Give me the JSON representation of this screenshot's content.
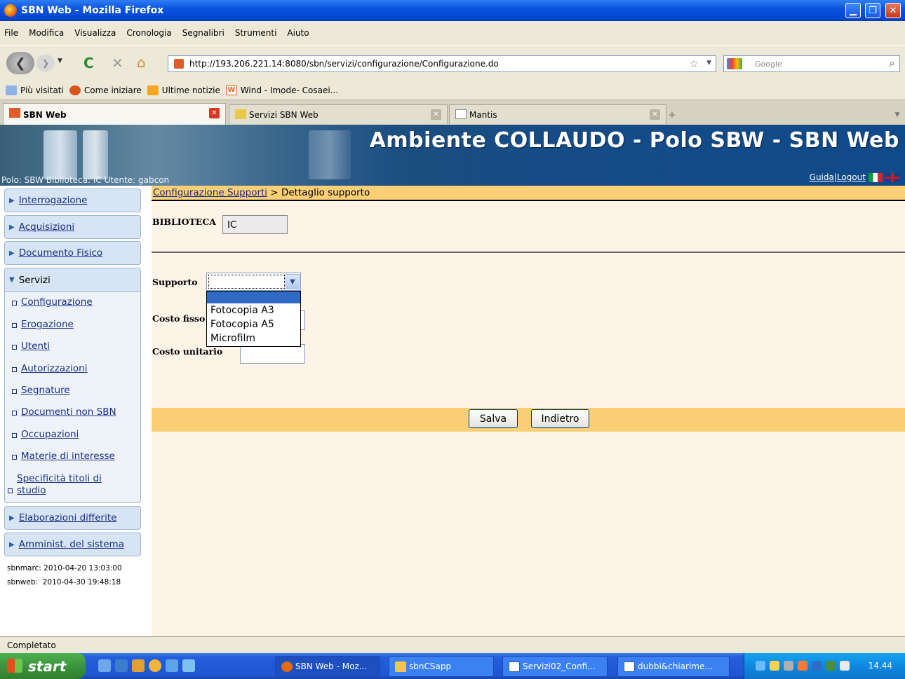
{
  "window": {
    "title": "SBN Web - Mozilla Firefox"
  },
  "menu": [
    "File",
    "Modifica",
    "Visualizza",
    "Cronologia",
    "Segnalibri",
    "Strumenti",
    "Aiuto"
  ],
  "navbar": {
    "url": "http://193.206.221.14:8080/sbn/servizi/configurazione/Configurazione.do",
    "search_placeholder": "Google"
  },
  "bookmarks": [
    "Più visitati",
    "Come iniziare",
    "Ultime notizie",
    "Wind - Imode- Cosaei..."
  ],
  "tabs": [
    {
      "label": "SBN Web",
      "active": true
    },
    {
      "label": "Servizi SBN Web",
      "active": false
    },
    {
      "label": "Mantis",
      "active": false
    }
  ],
  "banner": {
    "title": "Ambiente COLLAUDO - Polo SBW - SBN Web",
    "info": "Polo: SBW  Biblioteca: IC  Utente: gabcon",
    "guida": "Guida",
    "logout": "Logout",
    "separator": "|"
  },
  "sidebar": {
    "sections": [
      {
        "label": "Interrogazione"
      },
      {
        "label": "Acquisizioni"
      },
      {
        "label": "Documento Fisico"
      }
    ],
    "servizi": {
      "label": "Servizi",
      "items": [
        "Configurazione",
        "Erogazione",
        "Utenti",
        "Autorizzazioni",
        "Segnature",
        "Documenti non SBN",
        "Occupazioni",
        "Materie di interesse",
        "Specificità titoli di studio"
      ]
    },
    "bottom_sections": [
      {
        "label": "Elaborazioni differite"
      },
      {
        "label": "Amminist. del sistema"
      }
    ],
    "versions": [
      "sbnmarc: 2010-04-20 13:03:00",
      "sbnweb:  2010-04-30 19:48:18"
    ]
  },
  "main": {
    "crumb_link": "Configurazione Supporti",
    "crumb_rest": " > Dettaglio supporto",
    "biblioteca_label": "BIBLIOTECA",
    "biblioteca_value": "IC",
    "supporto_label": "Supporto",
    "supporto_value": "",
    "supporto_options": [
      "",
      "Fotocopia A3",
      "Fotocopia A5",
      "Microfilm"
    ],
    "costo_fisso_label": "Costo fisso",
    "costo_unitario_label": "Costo unitario",
    "save_label": "Salva",
    "back_label": "Indietro"
  },
  "status": "Completato",
  "taskbar": {
    "start": "start",
    "tasks": [
      "SBN Web - Moz...",
      "sbnCSapp",
      "Servizi02_Confi...",
      "dubbi&chiarime..."
    ],
    "clock": "14.44"
  }
}
